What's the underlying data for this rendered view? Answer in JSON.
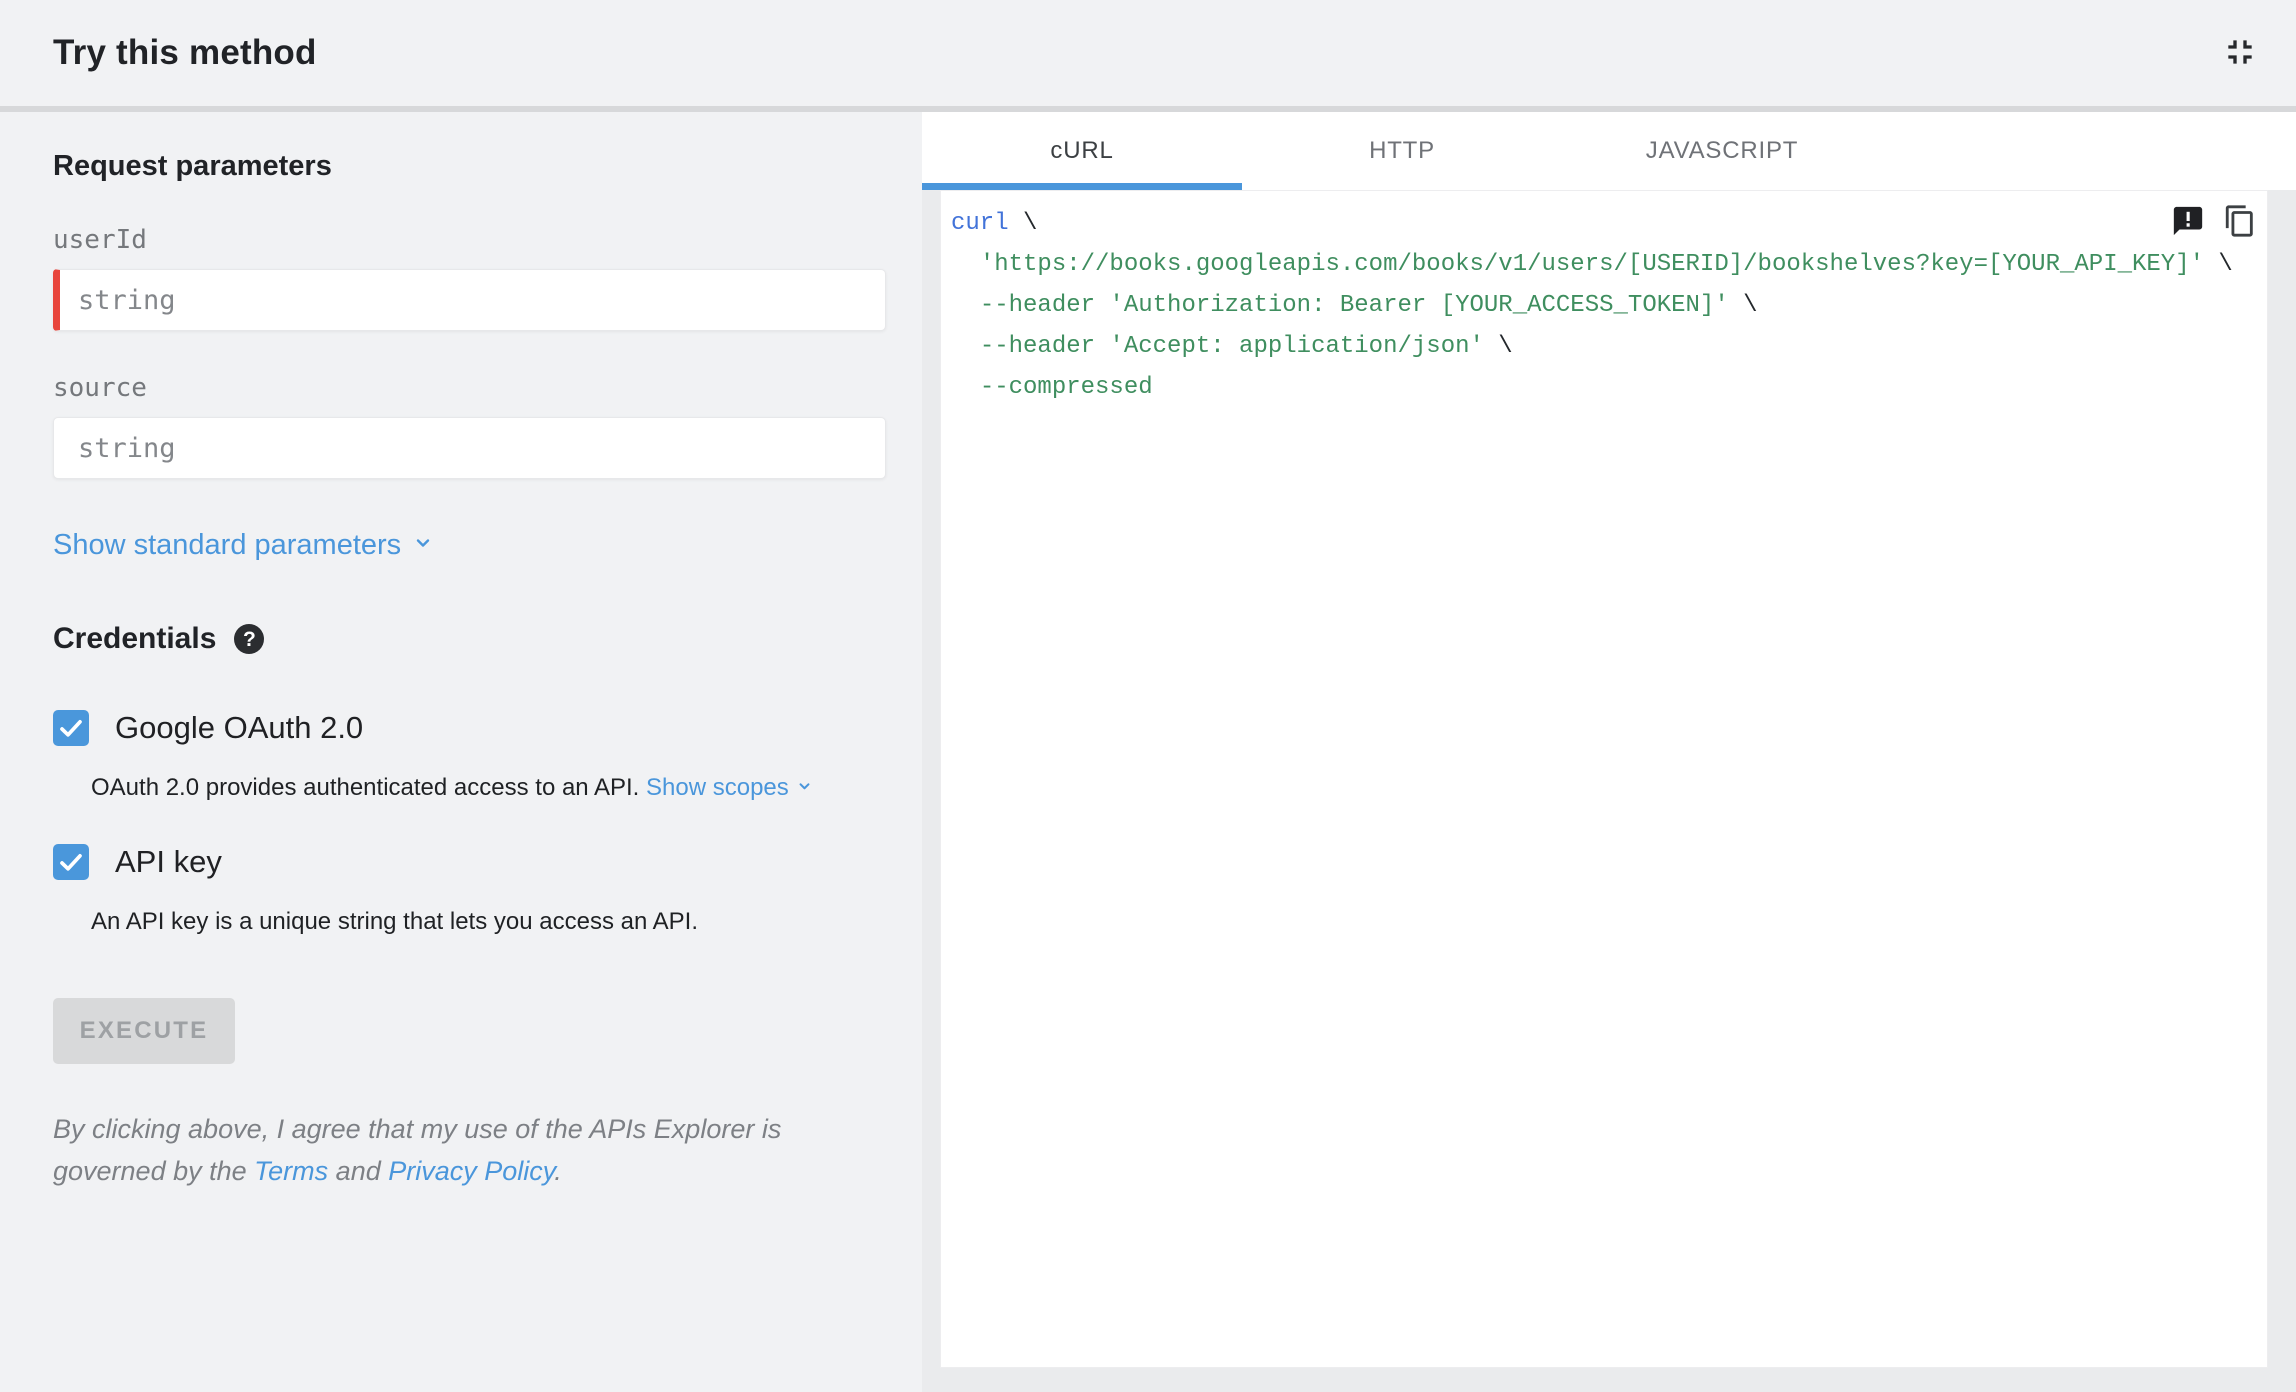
{
  "header": {
    "title": "Try this method"
  },
  "left": {
    "request_parameters_title": "Request parameters",
    "fields": [
      {
        "name": "userId",
        "placeholder": "string",
        "required": true
      },
      {
        "name": "source",
        "placeholder": "string",
        "required": false
      }
    ],
    "show_standard_parameters": "Show standard parameters",
    "credentials_title": "Credentials",
    "credentials": [
      {
        "label": "Google OAuth 2.0",
        "checked": true,
        "description": "OAuth 2.0 provides authenticated access to an API.",
        "link_label": "Show scopes"
      },
      {
        "label": "API key",
        "checked": true,
        "description": "An API key is a unique string that lets you access an API.",
        "link_label": ""
      }
    ],
    "execute_label": "EXECUTE",
    "execute_disabled": true,
    "disclaimer": {
      "text_before": "By clicking above, I agree that my use of the APIs Explorer is governed by the ",
      "terms_link": "Terms",
      "text_middle": " and ",
      "privacy_link": "Privacy Policy",
      "text_after": "."
    }
  },
  "right": {
    "tabs": [
      {
        "label": "cURL",
        "active": true
      },
      {
        "label": "HTTP",
        "active": false
      },
      {
        "label": "JAVASCRIPT",
        "active": false
      }
    ],
    "code_lines": [
      [
        {
          "type": "keyword",
          "text": "curl"
        },
        {
          "type": "plain",
          "text": " \\"
        }
      ],
      [
        {
          "type": "plain",
          "text": "  "
        },
        {
          "type": "string",
          "text": "'https://books.googleapis.com/books/v1/users/[USERID]/bookshelves?key=[YOUR_API_KEY]'"
        },
        {
          "type": "plain",
          "text": " \\"
        }
      ],
      [
        {
          "type": "plain",
          "text": "  "
        },
        {
          "type": "string",
          "text": "--header 'Authorization: Bearer [YOUR_ACCESS_TOKEN]'"
        },
        {
          "type": "plain",
          "text": " \\"
        }
      ],
      [
        {
          "type": "plain",
          "text": "  "
        },
        {
          "type": "string",
          "text": "--header 'Accept: application/json'"
        },
        {
          "type": "plain",
          "text": " \\"
        }
      ],
      [
        {
          "type": "plain",
          "text": "  "
        },
        {
          "type": "string",
          "text": "--compressed"
        }
      ]
    ],
    "icons": [
      "feedback-icon",
      "copy-icon"
    ]
  },
  "colors": {
    "accent_blue": "#4a96db",
    "checkbox_blue": "#4a97db",
    "required_red": "#e8453c",
    "tab_indicator": "#4a96db",
    "code_keyword": "#4273d9",
    "code_string": "#3f8e5f",
    "code_plain": "#24282c",
    "panel_background": "#f1f2f4",
    "execute_disabled_bg": "#d8d9da"
  }
}
